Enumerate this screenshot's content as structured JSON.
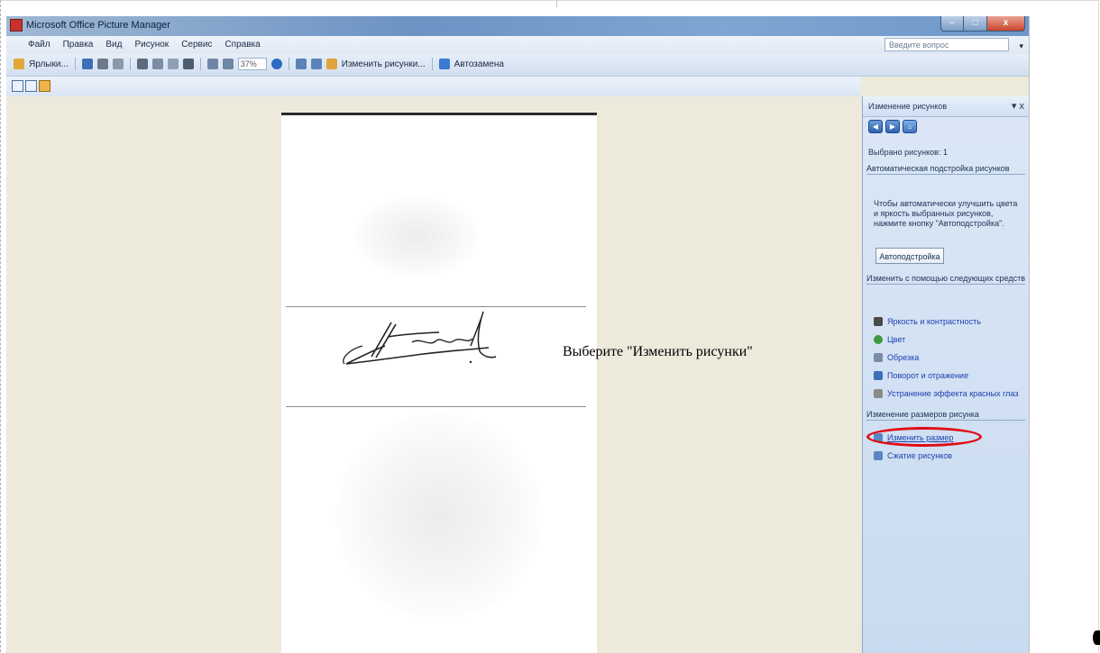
{
  "window": {
    "title": "Microsoft Office Picture Manager",
    "buttons": {
      "minimize": "–",
      "maximize": "□",
      "close": "x"
    }
  },
  "menu": {
    "items": [
      "Файл",
      "Правка",
      "Вид",
      "Рисунок",
      "Сервис",
      "Справка"
    ],
    "help_placeholder": "Введите вопрос",
    "help_arrow": "▾"
  },
  "toolbar": {
    "shortcuts_label": "Ярлыки...",
    "zoom_value": "37%",
    "edit_pictures_label": "Изменить рисунки...",
    "autocorrect_label": "Автозамена"
  },
  "taskpane": {
    "title": "Изменение рисунков",
    "controls": "▾ x",
    "selected": "Выбрано рисунков: 1",
    "section_auto": "Автоматическая подстройка рисунков",
    "auto_description": "Чтобы автоматически улучшить цвета и яркость выбранных рисунков, нажмите кнопку \"Автоподстройка\".",
    "auto_button": "Автоподстройка",
    "section_tools": "Изменить с помощью следующих средств",
    "tools": [
      "Яркость и контрастность",
      "Цвет",
      "Обрезка",
      "Поворот и отражение",
      "Устранение эффекта красных глаз"
    ],
    "section_resize": "Изменение размеров рисунка",
    "resize_links": [
      "Изменить размер",
      "Сжатие рисунков"
    ]
  },
  "annotation": "Выберите \"Изменить рисунки\""
}
